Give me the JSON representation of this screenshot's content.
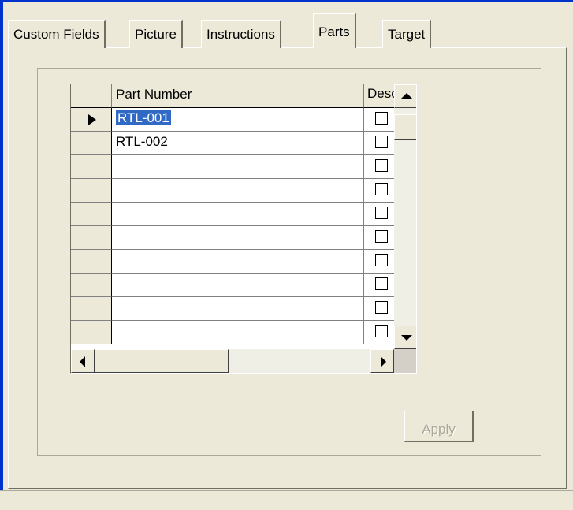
{
  "tabs": [
    "Custom Fields",
    "Picture",
    "Instructions",
    "Parts",
    "Target"
  ],
  "active_tab": "Parts",
  "grid": {
    "columns": {
      "part_number": "Part Number",
      "description": "Description"
    },
    "rows": [
      {
        "part_number": "RTL-001",
        "current": true,
        "selected": true,
        "checked": false
      },
      {
        "part_number": "RTL-002",
        "current": false,
        "selected": false,
        "checked": false
      },
      {
        "part_number": "",
        "current": false,
        "selected": false,
        "checked": false
      },
      {
        "part_number": "",
        "current": false,
        "selected": false,
        "checked": false
      },
      {
        "part_number": "",
        "current": false,
        "selected": false,
        "checked": false
      },
      {
        "part_number": "",
        "current": false,
        "selected": false,
        "checked": false
      },
      {
        "part_number": "",
        "current": false,
        "selected": false,
        "checked": false
      },
      {
        "part_number": "",
        "current": false,
        "selected": false,
        "checked": false
      },
      {
        "part_number": "",
        "current": false,
        "selected": false,
        "checked": false
      },
      {
        "part_number": "",
        "current": false,
        "selected": false,
        "checked": false
      }
    ]
  },
  "buttons": {
    "apply": "Apply"
  },
  "colors": {
    "selection": "#316ac5",
    "window_frame": "#0033cc",
    "panel": "#ece9d8"
  }
}
